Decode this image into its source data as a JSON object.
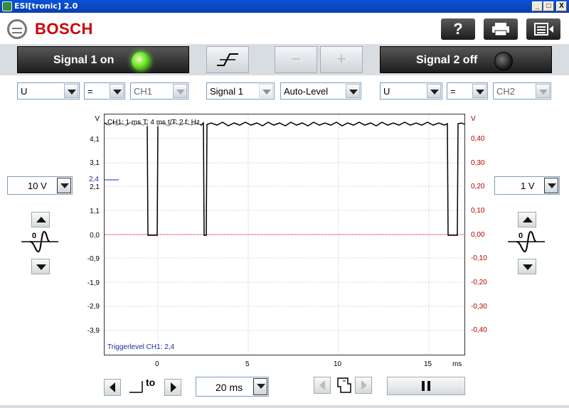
{
  "window": {
    "title": "ESI[tronic] 2.0",
    "btn_min": "_",
    "btn_max": "□",
    "btn_close": "X"
  },
  "header": {
    "brand": "BOSCH",
    "help_label": "?"
  },
  "signal1": {
    "label": "Signal 1 on"
  },
  "signal2": {
    "label": "Signal 2 off"
  },
  "toolbar": {
    "minus_label": "−",
    "plus_label": "+"
  },
  "controls_left": {
    "measure": "U",
    "op": "=",
    "channel": "CH1"
  },
  "trigger": {
    "source": "Signal 1",
    "mode": "Auto-Level"
  },
  "controls_right": {
    "measure": "U",
    "op": "=",
    "channel": "CH2"
  },
  "range_left": "10 V",
  "range_right": "1 V",
  "timebase": "20 ms",
  "plot": {
    "left_unit": "V",
    "right_unit": "V",
    "left_ticks": [
      "4,1",
      "3,1",
      "2,1",
      "1,1",
      "0,0",
      "-0,9",
      "-1,9",
      "-2,9",
      "-3,9"
    ],
    "right_ticks": [
      "0,40",
      "0,30",
      "0,20",
      "0,10",
      "0,00",
      "-0,10",
      "-0,20",
      "-0,30",
      "-0,40"
    ],
    "x_ticks": [
      "0",
      "5",
      "10",
      "15"
    ],
    "x_unit": "ms",
    "trigger_marker": "2,4",
    "channel_info": "CH1: 1 ms T: 4 ms t/T: 2 f: Hz",
    "trigger_text": "Triggerlevel CH1: 2,4",
    "trigger_to_label": "to"
  },
  "colors": {
    "ch1": "#000000",
    "ch2": "#b00000",
    "trigger": "#1a2ca0"
  }
}
